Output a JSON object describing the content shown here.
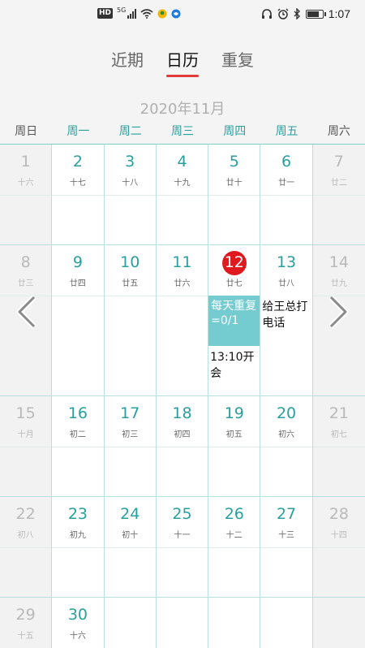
{
  "status": {
    "left_badge": "HD",
    "network": "5G",
    "time": "1:07",
    "battery_level": 0.85
  },
  "tabs": [
    {
      "label": "近期"
    },
    {
      "label": "日历"
    },
    {
      "label": "重复"
    }
  ],
  "calendar": {
    "month_title": "2020年11月",
    "weekdays": [
      "周日",
      "周一",
      "周二",
      "周三",
      "周四",
      "周五",
      "周六"
    ],
    "weeks": [
      [
        {
          "num": "1",
          "lunar": "十六"
        },
        {
          "num": "2",
          "lunar": "十七"
        },
        {
          "num": "3",
          "lunar": "十八"
        },
        {
          "num": "4",
          "lunar": "十九"
        },
        {
          "num": "5",
          "lunar": "廿十"
        },
        {
          "num": "6",
          "lunar": "廿一"
        },
        {
          "num": "7",
          "lunar": "廿二"
        }
      ],
      [
        {
          "num": "8",
          "lunar": "廿三"
        },
        {
          "num": "9",
          "lunar": "廿四"
        },
        {
          "num": "10",
          "lunar": "廿五"
        },
        {
          "num": "11",
          "lunar": "廿六"
        },
        {
          "num": "12",
          "lunar": "廿七"
        },
        {
          "num": "13",
          "lunar": "廿八"
        },
        {
          "num": "14",
          "lunar": "廿九"
        }
      ],
      [
        {
          "num": "15",
          "lunar": "十月"
        },
        {
          "num": "16",
          "lunar": "初二"
        },
        {
          "num": "17",
          "lunar": "初三"
        },
        {
          "num": "18",
          "lunar": "初四"
        },
        {
          "num": "19",
          "lunar": "初五"
        },
        {
          "num": "20",
          "lunar": "初六"
        },
        {
          "num": "21",
          "lunar": "初七"
        }
      ],
      [
        {
          "num": "22",
          "lunar": "初八"
        },
        {
          "num": "23",
          "lunar": "初九"
        },
        {
          "num": "24",
          "lunar": "初十"
        },
        {
          "num": "25",
          "lunar": "十一"
        },
        {
          "num": "26",
          "lunar": "十二"
        },
        {
          "num": "27",
          "lunar": "十三"
        },
        {
          "num": "28",
          "lunar": "十四"
        }
      ],
      [
        {
          "num": "29",
          "lunar": "十五"
        },
        {
          "num": "30",
          "lunar": "十六"
        }
      ]
    ],
    "events": {
      "repeat_daily": "每天重复=0/1",
      "meeting": "13:10开会",
      "call_wang": "给王总打电话"
    }
  }
}
